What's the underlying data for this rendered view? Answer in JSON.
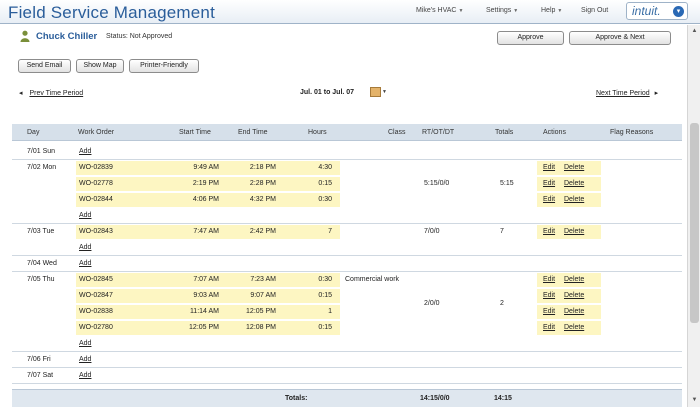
{
  "header": {
    "title": "Field Service Management",
    "company": "Mike's HVAC",
    "settings": "Settings",
    "help": "Help",
    "sign_out": "Sign Out",
    "logo": "intuit."
  },
  "employee": {
    "name": "Chuck Chiller",
    "status": "Status: Not Approved"
  },
  "buttons": {
    "approve": "Approve",
    "approve_next": "Approve & Next",
    "send_email": "Send Email",
    "show_map": "Show Map",
    "printer_friendly": "Printer-Friendly"
  },
  "period": {
    "prev": "Prev Time Period",
    "range": "Jul. 01 to Jul. 07",
    "next": "Next Time Period"
  },
  "columns": {
    "day": "Day",
    "work_order": "Work Order",
    "start": "Start Time",
    "end": "End Time",
    "hours": "Hours",
    "class": "Class",
    "rt": "RT/OT/DT",
    "totals": "Totals",
    "actions": "Actions",
    "flags": "Flag Reasons"
  },
  "labels": {
    "add": "Add",
    "edit": "Edit",
    "delete": "Delete"
  },
  "days": [
    {
      "day": "7/01 Sun",
      "rt": "",
      "total": "",
      "entries": []
    },
    {
      "day": "7/02 Mon",
      "rt": "5:15/0/0",
      "total": "5:15",
      "entries": [
        {
          "wo": "WO-02839",
          "start": "9:49 AM",
          "end": "2:18 PM",
          "hours": "4:30",
          "class": ""
        },
        {
          "wo": "WO-02778",
          "start": "2:19 PM",
          "end": "2:28 PM",
          "hours": "0:15",
          "class": ""
        },
        {
          "wo": "WO-02844",
          "start": "4:06 PM",
          "end": "4:32 PM",
          "hours": "0:30",
          "class": ""
        }
      ]
    },
    {
      "day": "7/03 Tue",
      "rt": "7/0/0",
      "total": "7",
      "entries": [
        {
          "wo": "WO-02843",
          "start": "7:47 AM",
          "end": "2:42 PM",
          "hours": "7",
          "class": ""
        }
      ]
    },
    {
      "day": "7/04 Wed",
      "rt": "",
      "total": "",
      "entries": []
    },
    {
      "day": "7/05 Thu",
      "rt": "2/0/0",
      "total": "2",
      "entries": [
        {
          "wo": "WO-02845",
          "start": "7:07 AM",
          "end": "7:23 AM",
          "hours": "0:30",
          "class": "Commercial work"
        },
        {
          "wo": "WO-02847",
          "start": "9:03 AM",
          "end": "9:07 AM",
          "hours": "0:15",
          "class": ""
        },
        {
          "wo": "WO-02838",
          "start": "11:14 AM",
          "end": "12:05 PM",
          "hours": "1",
          "class": ""
        },
        {
          "wo": "WO-02780",
          "start": "12:05 PM",
          "end": "12:08 PM",
          "hours": "0:15",
          "class": ""
        }
      ]
    },
    {
      "day": "7/06 Fri",
      "rt": "",
      "total": "",
      "entries": []
    },
    {
      "day": "7/07 Sat",
      "rt": "",
      "total": "",
      "entries": []
    }
  ],
  "totals": {
    "label": "Totals:",
    "rt": "14:15/0/0",
    "total": "14:15"
  }
}
